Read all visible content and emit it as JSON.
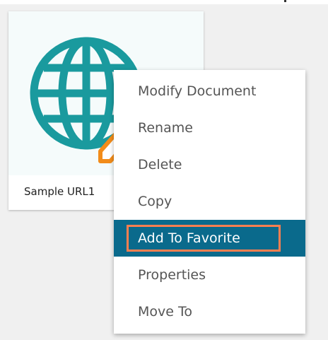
{
  "card": {
    "label": "Sample URL1",
    "icon": "globe-icon",
    "overlay_icon": "edit-icon"
  },
  "colors": {
    "globe": "#1a9a9e",
    "edit_overlay": "#f28c1a",
    "menu_selected_bg": "#0a6a8c",
    "highlight_border": "#ff7f50"
  },
  "menu": {
    "items": [
      {
        "label": "Modify Document"
      },
      {
        "label": "Rename"
      },
      {
        "label": "Delete"
      },
      {
        "label": "Copy"
      },
      {
        "label": "Add To Favorite",
        "selected": true
      },
      {
        "label": "Properties"
      },
      {
        "label": "Move To"
      }
    ]
  }
}
